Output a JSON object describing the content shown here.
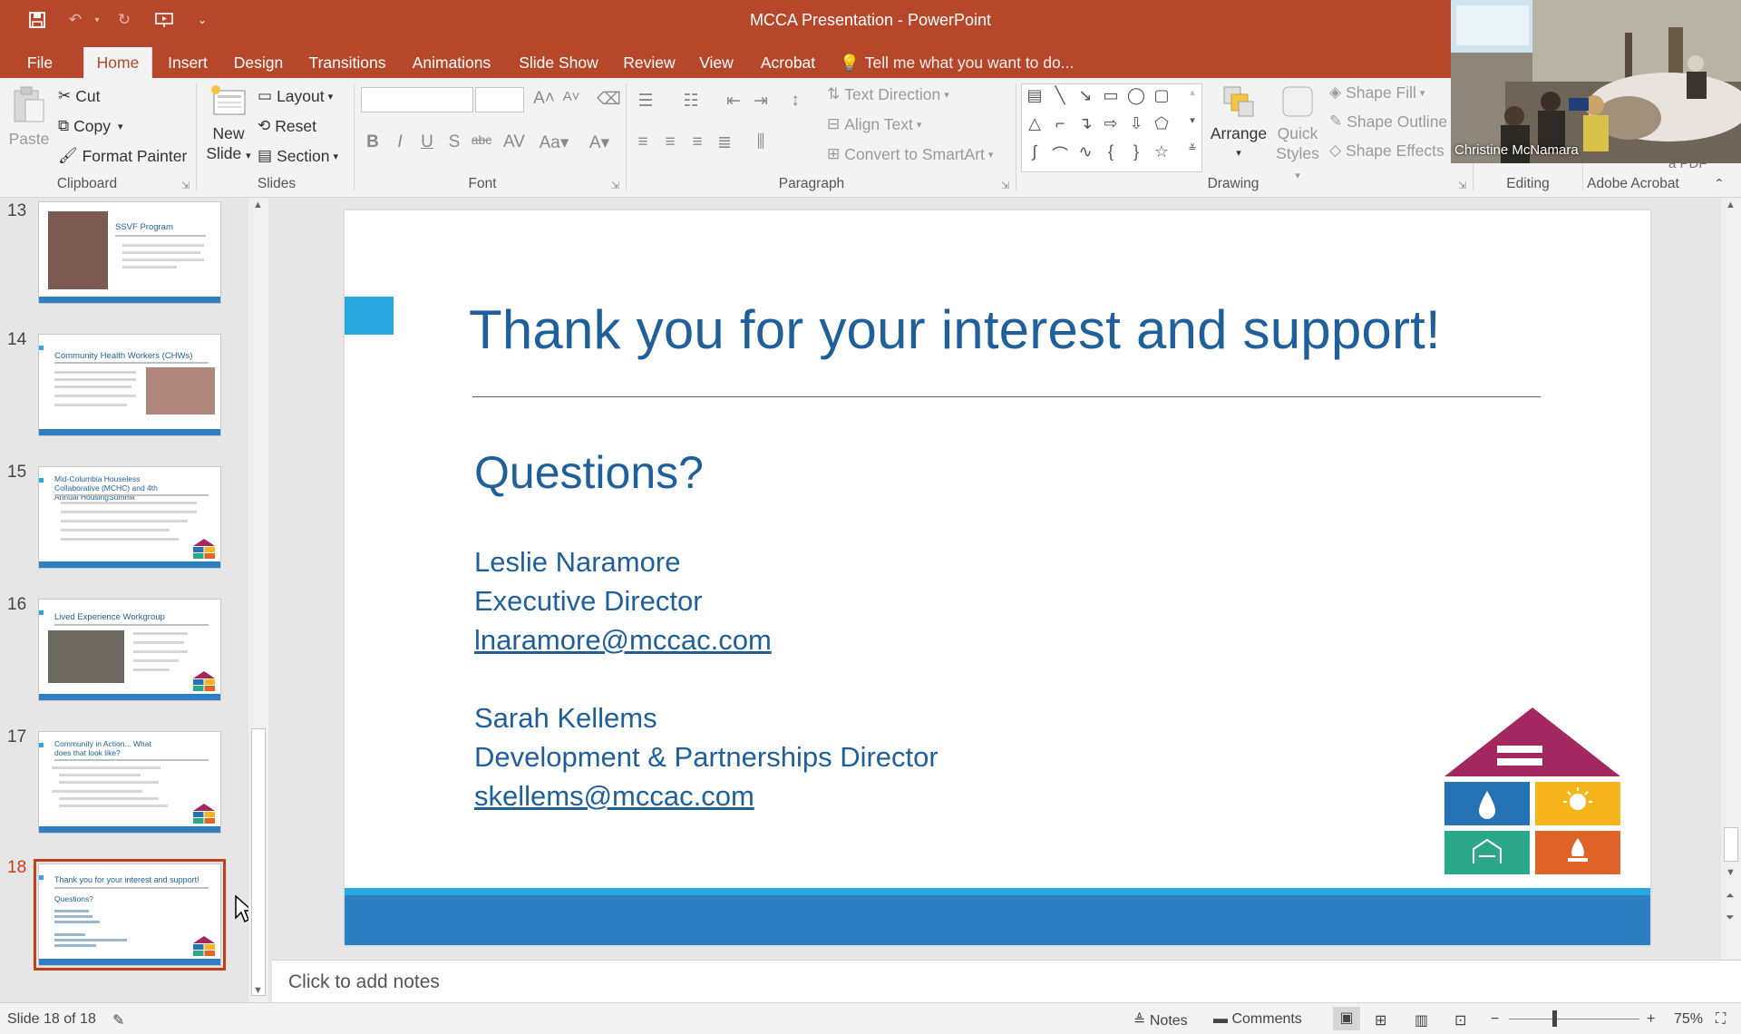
{
  "window": {
    "title": "MCCA Presentation - PowerPoint"
  },
  "tabs": [
    {
      "label": "File"
    },
    {
      "label": "Home"
    },
    {
      "label": "Insert"
    },
    {
      "label": "Design"
    },
    {
      "label": "Transitions"
    },
    {
      "label": "Animations"
    },
    {
      "label": "Slide Show"
    },
    {
      "label": "Review"
    },
    {
      "label": "View"
    },
    {
      "label": "Acrobat"
    }
  ],
  "tell_me": "Tell me what you want to do...",
  "ribbon": {
    "clipboard": {
      "paste": "Paste",
      "cut": "Cut",
      "copy": "Copy",
      "format_painter": "Format Painter",
      "label": "Clipboard"
    },
    "slides": {
      "new_slide_1": "New",
      "new_slide_2": "Slide",
      "layout": "Layout",
      "reset": "Reset",
      "section": "Section",
      "label": "Slides"
    },
    "font": {
      "label": "Font"
    },
    "paragraph": {
      "text_direction": "Text Direction",
      "align_text": "Align Text",
      "convert_smartart": "Convert to SmartArt",
      "label": "Paragraph"
    },
    "drawing": {
      "arrange": "Arrange",
      "quick_1": "Quick",
      "quick_2": "Styles",
      "shape_fill": "Shape Fill",
      "shape_outline": "Shape Outline",
      "shape_effects": "Shape Effects",
      "label": "Drawing"
    },
    "editing": {
      "label": "Editing"
    },
    "acrobat": {
      "label": "Adobe Acrobat",
      "partial": "a PDF"
    }
  },
  "webcam": {
    "name": "Christine McNamara"
  },
  "thumbnails": [
    {
      "num": "13",
      "title": "SSVF Program"
    },
    {
      "num": "14",
      "title": "Community Health Workers (CHWs)"
    },
    {
      "num": "15",
      "title": "Mid-Columbia Houseless Collaborative (MCHC) and 4th Annual HousingSummit"
    },
    {
      "num": "16",
      "title": "Lived Experience Workgroup"
    },
    {
      "num": "17",
      "title": "Community in Action... What does that look like?"
    },
    {
      "num": "18",
      "title": "Thank you for your interest and support!",
      "sub": "Questions?"
    }
  ],
  "slide": {
    "title": "Thank you for your interest and support!",
    "questions": "Questions?",
    "contact1_name": "Leslie Naramore",
    "contact1_role": "Executive Director",
    "contact1_email": "lnaramore@mccac.com",
    "contact2_name": "Sarah Kellems",
    "contact2_role": "Development & Partnerships Director",
    "contact2_email": "skellems@mccac.com"
  },
  "logo_colors": {
    "roof": "#a3285f",
    "water": "#2373b5",
    "light": "#f6b61b",
    "home": "#2aa889",
    "fire": "#e0632a"
  },
  "notes": {
    "placeholder": "Click to add notes"
  },
  "status": {
    "slide_info": "Slide 18 of 18",
    "notes": "Notes",
    "comments": "Comments",
    "zoom": "75%"
  }
}
